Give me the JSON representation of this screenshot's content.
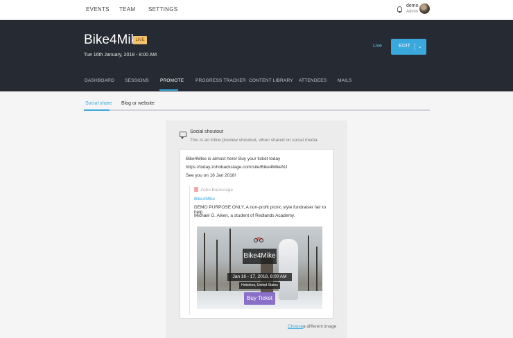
{
  "topnav": {
    "items": [
      "EVENTS",
      "TEAM",
      "SETTINGS"
    ],
    "user_name": "demo",
    "user_role": "Admin"
  },
  "event": {
    "title": "Bike4Mike",
    "badge": "LIVE",
    "date": "Tue 16th January, 2018 - 8:00 AM",
    "status": "Live",
    "edit_label": "EDIT"
  },
  "tabs": [
    "DASHBOARD",
    "SESSIONS",
    "PROMOTE",
    "PROGRESS TRACKER",
    "CONTENT LIBRARY",
    "ATTENDEES",
    "MAILS"
  ],
  "active_tab": "PROMOTE",
  "subtabs": [
    "Social share",
    "Blog or website"
  ],
  "shoutout": {
    "title": "Social shoutout",
    "description": "This is an inline preview shoutout, when shared on social media.",
    "post_lines": [
      "Bike4Mike is almost here! Buy your ticket today",
      "https://today.zohobackstage.com/site/Bike4MikeNJ",
      "See you on 16 Jan 2018!"
    ],
    "source": "Zoho Backstage",
    "link_title": "Bike4Mike",
    "desc_lines": [
      "DEMO PURPOSE ONLY, A non-profit picnic style fundraiser fair to help",
      "Michael G. Aiken, a student of Redlands Academy."
    ],
    "image": {
      "title": "Bike4Mike",
      "date": "Jan 16 - 17, 2018, 8:00 AM (EST)",
      "location": "Hoboken, United States",
      "buy_label": "Buy Ticket"
    },
    "choose_label": "Choose",
    "choose_rest": "a different image"
  },
  "colors": {
    "accent": "#3aa8dc",
    "header_bg": "#262b33",
    "badge_bg": "#f4c26a",
    "buy_ticket": "#8a6fc9"
  }
}
